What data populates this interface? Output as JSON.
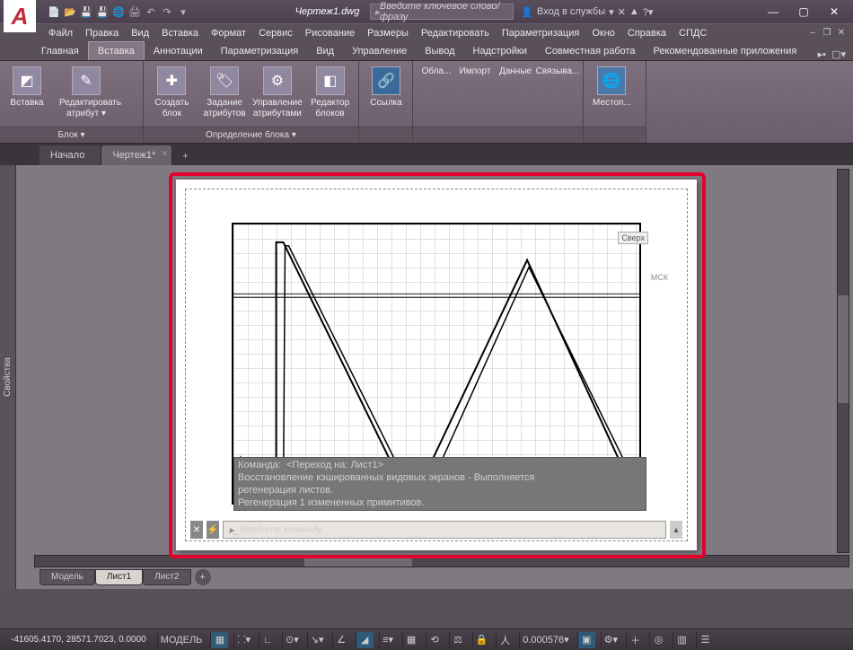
{
  "title": "Чертеж1.dwg",
  "search_placeholder": "Введите ключевое слово/фразу",
  "login_label": "Вход в службы",
  "menu": [
    "Файл",
    "Правка",
    "Вид",
    "Вставка",
    "Формат",
    "Сервис",
    "Рисование",
    "Размеры",
    "Редактировать",
    "Параметризация",
    "Окно",
    "Справка",
    "СПДС"
  ],
  "ribbon_tabs": [
    "Главная",
    "Вставка",
    "Аннотации",
    "Параметризация",
    "Вид",
    "Управление",
    "Вывод",
    "Надстройки",
    "Совместная работа",
    "Рекомендованные приложения"
  ],
  "active_ribbon_tab": 1,
  "panels": {
    "p0": {
      "label": "Блок ▾",
      "btns": [
        {
          "ico": "⬛",
          "label": "Вставка"
        },
        {
          "ico": "✎",
          "label": "Редактировать атрибут ▾"
        }
      ]
    },
    "p1": {
      "label": "Определение блока ▾",
      "btns": [
        {
          "ico": "✚",
          "label": "Создать блок"
        },
        {
          "ico": "🏷",
          "label": "Задание атрибутов"
        },
        {
          "ico": "⚙",
          "label": "Управление атрибутами"
        },
        {
          "ico": "◧",
          "label": "Редактор блоков"
        }
      ]
    },
    "p2": {
      "label": "",
      "btns": [
        {
          "ico": "🔗",
          "label": "Ссылка"
        }
      ]
    },
    "p3": {
      "label": "",
      "btns": [
        {
          "ico": "",
          "label": "Обла..."
        },
        {
          "ico": "",
          "label": "Импорт"
        },
        {
          "ico": "",
          "label": "Данные"
        },
        {
          "ico": "",
          "label": "Связыва..."
        }
      ]
    },
    "p4": {
      "label": "",
      "btns": [
        {
          "ico": "📍",
          "label": "Местоп..."
        }
      ]
    }
  },
  "doc_tabs": [
    {
      "label": "Начало",
      "active": false
    },
    {
      "label": "Чертеж1*",
      "active": true
    }
  ],
  "side_palette": "Свойства",
  "viewcube": "Сверх",
  "wcs": "МСК",
  "cmd_history": [
    "Команда:  <Переход на: Лист1>",
    "Восстановление кэшированных видовых экранов - Выполняется",
    "регенерация листов.",
    "Регенерация 1 измененных примитивов."
  ],
  "cmd_placeholder": "Введите команду",
  "layout_tabs": [
    {
      "label": "Модель",
      "active": false
    },
    {
      "label": "Лист1",
      "active": true
    },
    {
      "label": "Лист2",
      "active": false
    }
  ],
  "status": {
    "coords": "-41605.4170, 28571.7023, 0.0000",
    "space": "МОДЕЛЬ",
    "scale": "0.000576"
  }
}
